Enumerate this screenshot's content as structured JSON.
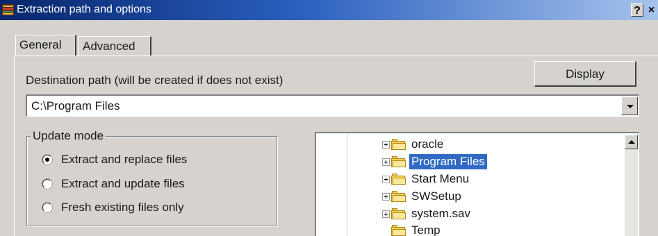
{
  "window": {
    "title": "Extraction path and options",
    "help_label": "?",
    "close_label": "×"
  },
  "tabs": [
    {
      "label": "General",
      "active": true
    },
    {
      "label": "Advanced",
      "active": false
    }
  ],
  "destination": {
    "label": "Destination path (will be created if does not exist)",
    "value": "C:\\Program Files",
    "display_button": "Display"
  },
  "update_mode": {
    "title": "Update mode",
    "options": [
      {
        "label": "Extract and replace files",
        "checked": true
      },
      {
        "label": "Extract and update files",
        "checked": false
      },
      {
        "label": "Fresh existing files only",
        "checked": false
      }
    ]
  },
  "folder_tree": {
    "items": [
      {
        "label": "oracle",
        "expandable": true,
        "selected": false
      },
      {
        "label": "Program Files",
        "expandable": true,
        "selected": true
      },
      {
        "label": "Start Menu",
        "expandable": true,
        "selected": false
      },
      {
        "label": "SWSetup",
        "expandable": true,
        "selected": false
      },
      {
        "label": "system.sav",
        "expandable": true,
        "selected": false
      },
      {
        "label": "Temp",
        "expandable": false,
        "selected": false
      }
    ]
  },
  "colors": {
    "titlebar_start": "#07256b",
    "titlebar_end": "#a6c3ec",
    "selection": "#316ac5",
    "dialog_bg": "#d6d3ce"
  }
}
